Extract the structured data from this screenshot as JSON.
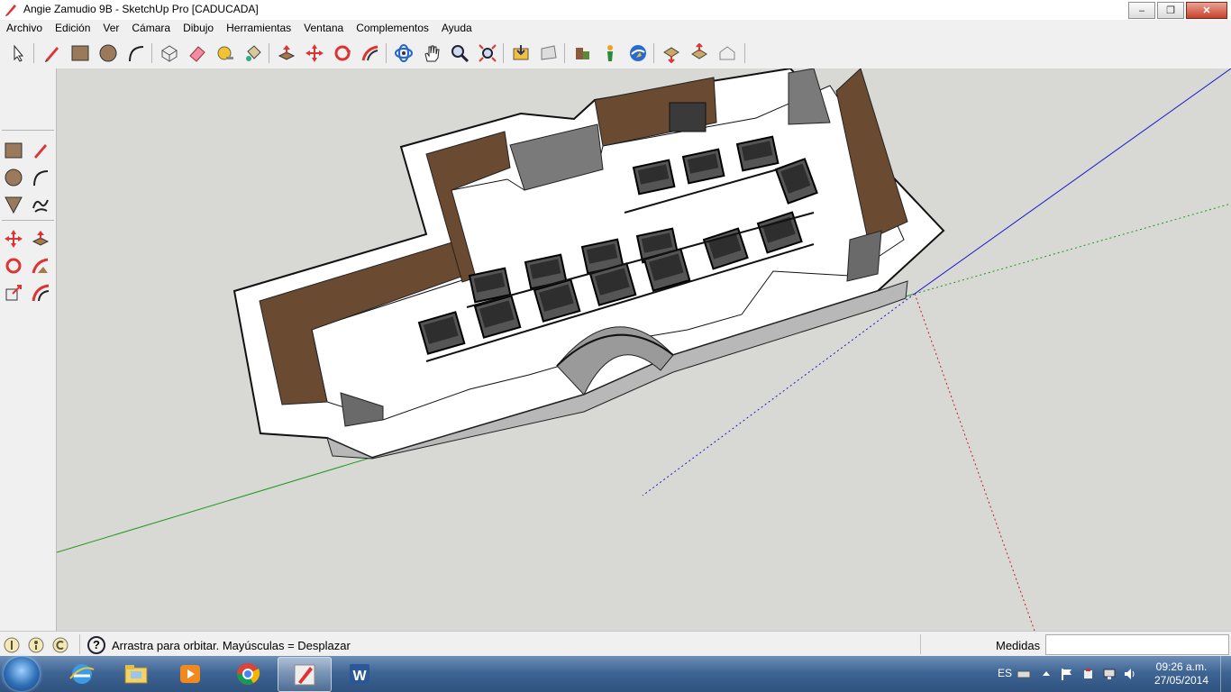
{
  "window": {
    "title": "Angie Zamudio 9B - SketchUp Pro [CADUCADA]",
    "minimize_glyph": "–",
    "maximize_glyph": "❐",
    "close_glyph": "✕"
  },
  "menu": {
    "items": [
      "Archivo",
      "Edición",
      "Ver",
      "Cámara",
      "Dibujo",
      "Herramientas",
      "Ventana",
      "Complementos",
      "Ayuda"
    ]
  },
  "toolbar": {
    "icons": [
      "select-icon",
      "pencil-icon",
      "rectangle-icon",
      "circle-icon",
      "arc-icon",
      "make-component-icon",
      "eraser-icon",
      "tape-measure-icon",
      "paint-bucket-icon",
      "push-pull-icon",
      "move-icon",
      "rotate-icon",
      "follow-me-icon",
      "orbit-icon",
      "pan-icon",
      "zoom-icon",
      "zoom-extents-icon",
      "get-models-icon",
      "share-model-icon",
      "warehouse-icon",
      "position-camera-icon",
      "google-earth-icon",
      "import-icon",
      "export-icon",
      "preview-icon"
    ]
  },
  "left_toolbar": {
    "icons": [
      "rectangle-icon",
      "line-icon",
      "circle-icon",
      "arc-icon",
      "polygon-icon",
      "freehand-icon",
      "move-icon",
      "push-pull-icon",
      "rotate-icon",
      "follow-me-icon",
      "scale-icon",
      "offset-icon"
    ]
  },
  "status": {
    "hint": "Arrastra para orbitar.  Mayúsculas = Desplazar",
    "help_glyph": "?",
    "measure_label": "Medidas",
    "measure_value": ""
  },
  "taskbar": {
    "apps": [
      "internet-explorer-icon",
      "file-explorer-icon",
      "media-player-icon",
      "chrome-icon",
      "sketchup-icon",
      "word-icon"
    ],
    "language": "ES",
    "time": "09:26 a.m.",
    "date": "27/05/2014"
  },
  "colors": {
    "viewport_bg": "#d8d8d4",
    "wall_brown": "#6b4a32",
    "axis_red": "#cc2222",
    "axis_green": "#22aa22",
    "axis_blue": "#2222cc"
  }
}
